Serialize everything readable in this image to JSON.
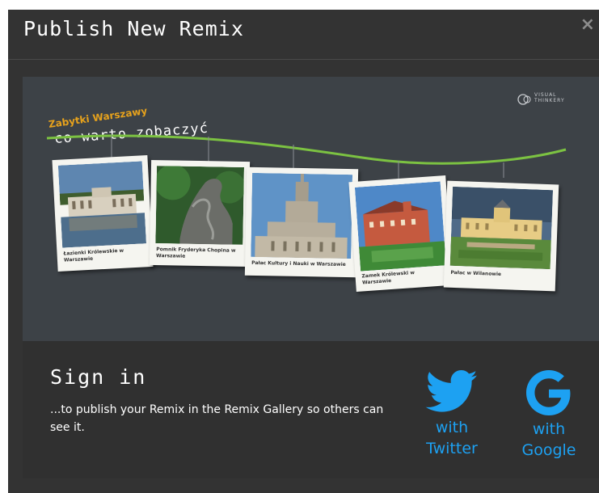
{
  "dialog": {
    "title": "Publish New Remix",
    "close_label": "×"
  },
  "preview": {
    "subtitle": "Zabytki Warszawy",
    "headline": "co warto zobaczyć",
    "logo_text_line1": "VISUAL",
    "logo_text_line2": "THINKERY",
    "photos": [
      {
        "caption": "Łazienki Królewskie w Warszawie"
      },
      {
        "caption": "Pomnik Fryderyka Chopina w Warszawie"
      },
      {
        "caption": "Pałac Kultury i Nauki w Warszawie"
      },
      {
        "caption": "Zamek Królewski w Warszawie"
      },
      {
        "caption": "Pałac w Wilanowie"
      }
    ],
    "colors": {
      "rope": "#7cc242",
      "background": "#3d4247",
      "subtitle": "#e7a21c"
    }
  },
  "signin": {
    "title": "Sign in",
    "description": "...to publish your Remix in the Remix Gallery so others can see it.",
    "twitter": {
      "with": "with",
      "name": "Twitter",
      "icon": "twitter-bird-icon"
    },
    "google": {
      "with": "with",
      "name": "Google",
      "icon": "google-g-icon"
    },
    "accent_color": "#1da1f2"
  }
}
